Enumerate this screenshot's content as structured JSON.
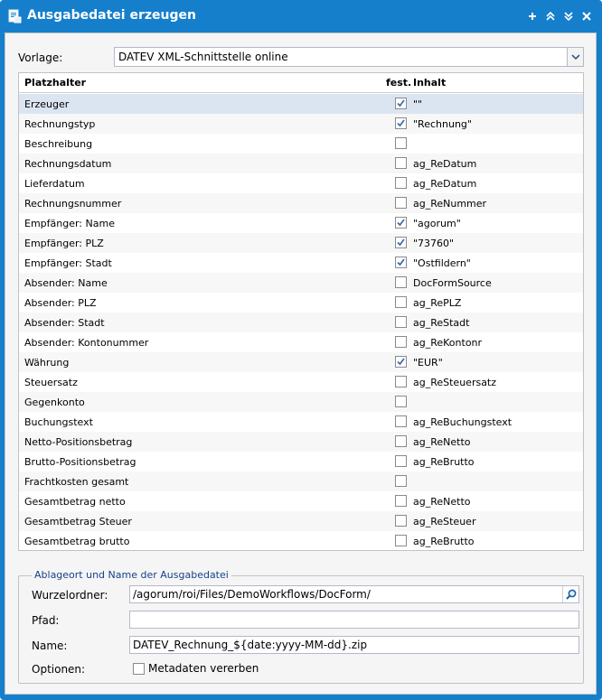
{
  "window": {
    "title": "Ausgabedatei erzeugen",
    "tools": [
      "plus-icon",
      "collapse-up-icon",
      "expand-down-icon",
      "close-icon"
    ]
  },
  "template": {
    "label": "Vorlage:",
    "value": "DATEV XML-Schnittstelle online"
  },
  "grid": {
    "columns": [
      "Platzhalter",
      "fest.",
      "Inhalt"
    ],
    "rows": [
      {
        "name": "Erzeuger",
        "fixed": true,
        "value": "\"\""
      },
      {
        "name": "Rechnungstyp",
        "fixed": true,
        "value": "\"Rechnung\""
      },
      {
        "name": "Beschreibung",
        "fixed": false,
        "value": ""
      },
      {
        "name": "Rechnungsdatum",
        "fixed": false,
        "value": "ag_ReDatum"
      },
      {
        "name": "Lieferdatum",
        "fixed": false,
        "value": "ag_ReDatum"
      },
      {
        "name": "Rechnungsnummer",
        "fixed": false,
        "value": "ag_ReNummer"
      },
      {
        "name": "Empfänger: Name",
        "fixed": true,
        "value": "\"agorum\""
      },
      {
        "name": "Empfänger: PLZ",
        "fixed": true,
        "value": "\"73760\""
      },
      {
        "name": "Empfänger: Stadt",
        "fixed": true,
        "value": "\"Ostfildern\""
      },
      {
        "name": "Absender: Name",
        "fixed": false,
        "value": "DocFormSource"
      },
      {
        "name": "Absender: PLZ",
        "fixed": false,
        "value": "ag_RePLZ"
      },
      {
        "name": "Absender: Stadt",
        "fixed": false,
        "value": "ag_ReStadt"
      },
      {
        "name": "Absender: Kontonummer",
        "fixed": false,
        "value": "ag_ReKontonr"
      },
      {
        "name": "Währung",
        "fixed": true,
        "value": "\"EUR\""
      },
      {
        "name": "Steuersatz",
        "fixed": false,
        "value": "ag_ReSteuersatz"
      },
      {
        "name": "Gegenkonto",
        "fixed": false,
        "value": ""
      },
      {
        "name": "Buchungstext",
        "fixed": false,
        "value": "ag_ReBuchungstext"
      },
      {
        "name": "Netto-Positionsbetrag",
        "fixed": false,
        "value": "ag_ReNetto"
      },
      {
        "name": "Brutto-Positionsbetrag",
        "fixed": false,
        "value": "ag_ReBrutto"
      },
      {
        "name": "Frachtkosten gesamt",
        "fixed": false,
        "value": ""
      },
      {
        "name": "Gesamtbetrag netto",
        "fixed": false,
        "value": "ag_ReNetto"
      },
      {
        "name": "Gesamtbetrag Steuer",
        "fixed": false,
        "value": "ag_ReSteuer"
      },
      {
        "name": "Gesamtbetrag brutto",
        "fixed": false,
        "value": "ag_ReBrutto"
      }
    ]
  },
  "output": {
    "legend": "Ablageort und Name der Ausgabedatei",
    "root_label": "Wurzelordner:",
    "root_value": "/agorum/roi/Files/DemoWorkflows/DocForm/",
    "path_label": "Pfad:",
    "path_value": "",
    "name_label": "Name:",
    "name_value": "DATEV_Rechnung_${date:yyyy-MM-dd}.zip",
    "options_label": "Optionen:",
    "inherit_label": "Metadaten vererben",
    "inherit_checked": false
  },
  "colors": {
    "window_blue": "#157fcc",
    "selected_row": "#dbe5f2",
    "legend_text": "#15428b"
  }
}
